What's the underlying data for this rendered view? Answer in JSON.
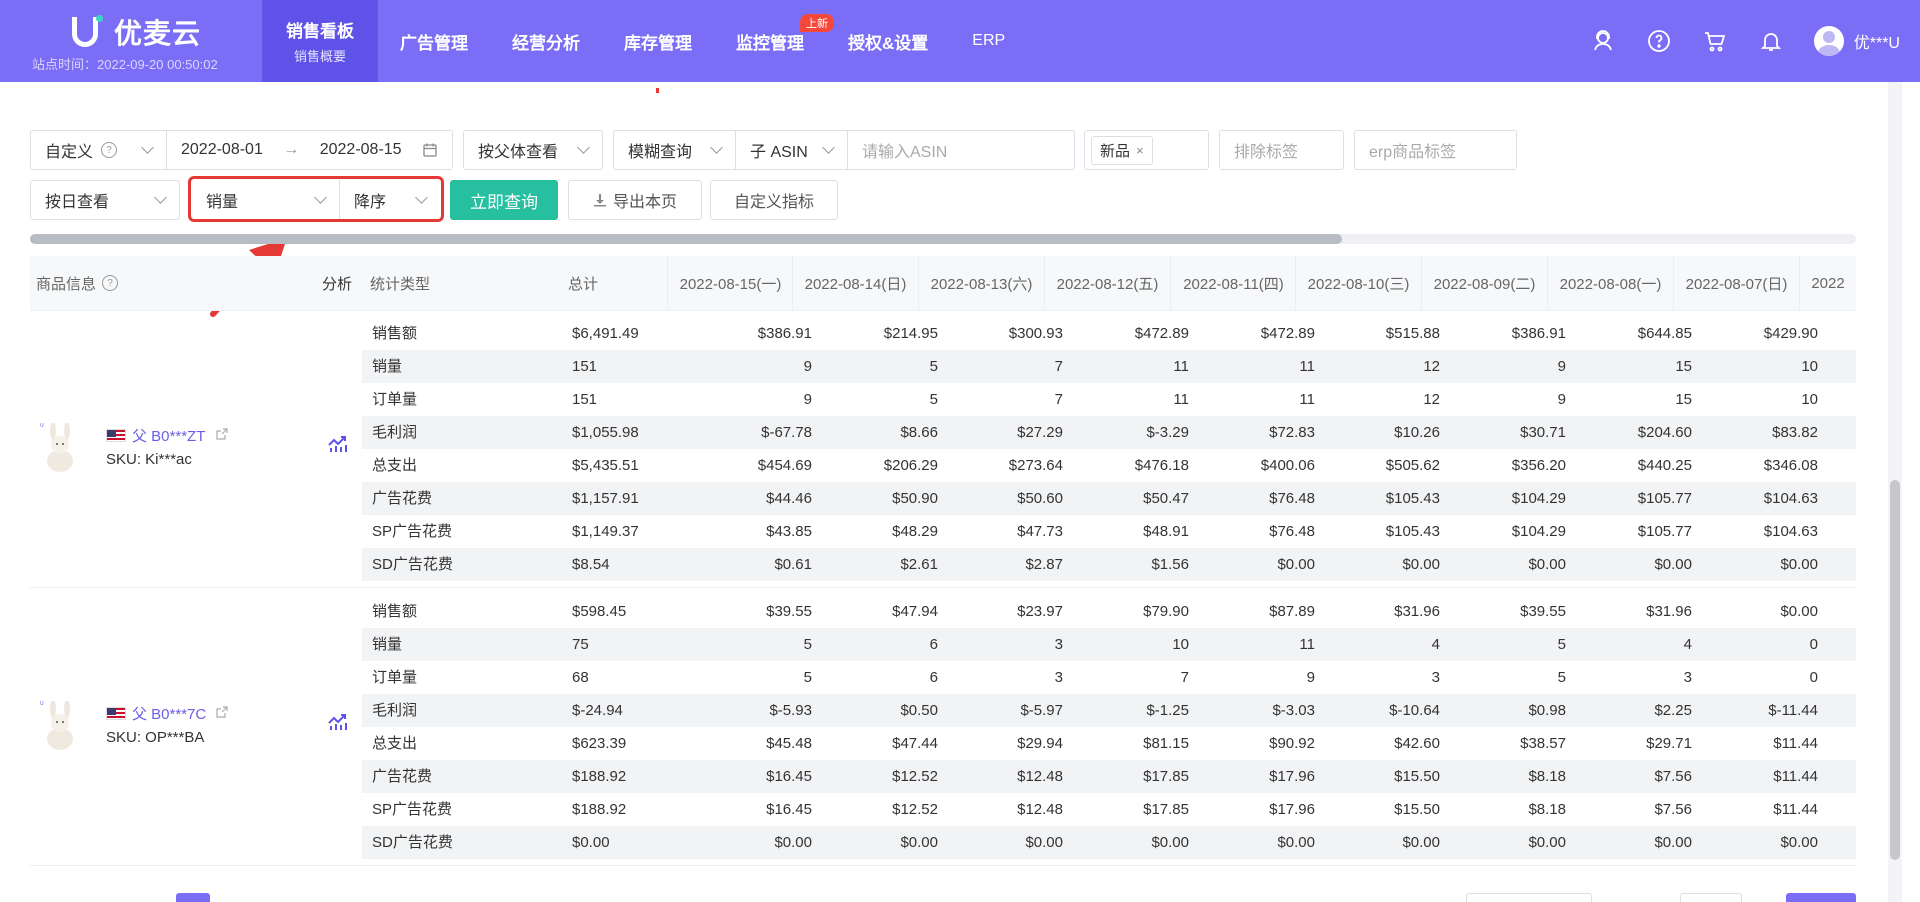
{
  "header": {
    "logo_text": "优麦云",
    "site_time": "站点时间：2022-09-20 00:50:02",
    "nav": [
      {
        "label": "销售看板",
        "sub": "销售概要",
        "active": true
      },
      {
        "label": "广告管理"
      },
      {
        "label": "经营分析"
      },
      {
        "label": "库存管理"
      },
      {
        "label": "监控管理",
        "badge": "上新"
      },
      {
        "label": "授权&设置"
      },
      {
        "label": "ERP"
      }
    ],
    "icons": [
      "support-icon",
      "help-icon",
      "cart-icon",
      "bell-icon"
    ],
    "user_name": "优***U"
  },
  "filters": {
    "date_mode": "自定义",
    "date_start": "2022-08-01",
    "date_end": "2022-08-15",
    "view_by": "按父体查看",
    "match_mode": "模糊查询",
    "asin_type": "子 ASIN",
    "asin_placeholder": "请输入ASIN",
    "tag_selected": "新品",
    "exclude_tag_placeholder": "排除标签",
    "erp_tag_placeholder": "erp商品标签",
    "period": "按日查看",
    "sort_field": "销量",
    "sort_order": "降序",
    "query_button": "立即查询",
    "export_button": "导出本页",
    "custom_metrics_button": "自定义指标"
  },
  "table": {
    "col_product": "商品信息",
    "col_analysis": "分析",
    "col_stat_type": "统计类型",
    "col_total": "总计",
    "date_columns": [
      "2022-08-15(一)",
      "2022-08-14(日)",
      "2022-08-13(六)",
      "2022-08-12(五)",
      "2022-08-11(四)",
      "2022-08-10(三)",
      "2022-08-09(二)",
      "2022-08-08(一)",
      "2022-08-07(日)",
      "2022"
    ],
    "products": [
      {
        "asin": "父 B0***ZT",
        "sku": "SKU: Ki***ac",
        "rows": [
          {
            "type": "销售额",
            "total": "$6,491.49",
            "values": [
              "$386.91",
              "$214.95",
              "$300.93",
              "$472.89",
              "$472.89",
              "$515.88",
              "$386.91",
              "$644.85",
              "$429.90"
            ]
          },
          {
            "type": "销量",
            "total": "151",
            "values": [
              "9",
              "5",
              "7",
              "11",
              "11",
              "12",
              "9",
              "15",
              "10"
            ]
          },
          {
            "type": "订单量",
            "total": "151",
            "values": [
              "9",
              "5",
              "7",
              "11",
              "11",
              "12",
              "9",
              "15",
              "10"
            ]
          },
          {
            "type": "毛利润",
            "total": "$1,055.98",
            "values": [
              "$-67.78",
              "$8.66",
              "$27.29",
              "$-3.29",
              "$72.83",
              "$10.26",
              "$30.71",
              "$204.60",
              "$83.82"
            ]
          },
          {
            "type": "总支出",
            "total": "$5,435.51",
            "values": [
              "$454.69",
              "$206.29",
              "$273.64",
              "$476.18",
              "$400.06",
              "$505.62",
              "$356.20",
              "$440.25",
              "$346.08"
            ]
          },
          {
            "type": "广告花费",
            "total": "$1,157.91",
            "values": [
              "$44.46",
              "$50.90",
              "$50.60",
              "$50.47",
              "$76.48",
              "$105.43",
              "$104.29",
              "$105.77",
              "$104.63"
            ]
          },
          {
            "type": "SP广告花费",
            "total": "$1,149.37",
            "values": [
              "$43.85",
              "$48.29",
              "$47.73",
              "$48.91",
              "$76.48",
              "$105.43",
              "$104.29",
              "$105.77",
              "$104.63"
            ]
          },
          {
            "type": "SD广告花费",
            "total": "$8.54",
            "values": [
              "$0.61",
              "$2.61",
              "$2.87",
              "$1.56",
              "$0.00",
              "$0.00",
              "$0.00",
              "$0.00",
              "$0.00"
            ]
          }
        ]
      },
      {
        "asin": "父 B0***7C",
        "sku": "SKU: OP***BA",
        "rows": [
          {
            "type": "销售额",
            "total": "$598.45",
            "values": [
              "$39.55",
              "$47.94",
              "$23.97",
              "$79.90",
              "$87.89",
              "$31.96",
              "$39.55",
              "$31.96",
              "$0.00"
            ]
          },
          {
            "type": "销量",
            "total": "75",
            "values": [
              "5",
              "6",
              "3",
              "10",
              "11",
              "4",
              "5",
              "4",
              "0"
            ]
          },
          {
            "type": "订单量",
            "total": "68",
            "values": [
              "5",
              "6",
              "3",
              "7",
              "9",
              "3",
              "5",
              "3",
              "0"
            ]
          },
          {
            "type": "毛利润",
            "total": "$-24.94",
            "values": [
              "$-5.93",
              "$0.50",
              "$-5.97",
              "$-1.25",
              "$-3.03",
              "$-10.64",
              "$0.98",
              "$2.25",
              "$-11.44"
            ]
          },
          {
            "type": "总支出",
            "total": "$623.39",
            "values": [
              "$45.48",
              "$47.44",
              "$29.94",
              "$81.15",
              "$90.92",
              "$42.60",
              "$38.57",
              "$29.71",
              "$11.44"
            ]
          },
          {
            "type": "广告花费",
            "total": "$188.92",
            "values": [
              "$16.45",
              "$12.52",
              "$12.48",
              "$17.85",
              "$17.96",
              "$15.50",
              "$8.18",
              "$7.56",
              "$11.44"
            ]
          },
          {
            "type": "SP广告花费",
            "total": "$188.92",
            "values": [
              "$16.45",
              "$12.52",
              "$12.48",
              "$17.85",
              "$17.96",
              "$15.50",
              "$8.18",
              "$7.56",
              "$11.44"
            ]
          },
          {
            "type": "SD广告花费",
            "total": "$0.00",
            "values": [
              "$0.00",
              "$0.00",
              "$0.00",
              "$0.00",
              "$0.00",
              "$0.00",
              "$0.00",
              "$0.00",
              "$0.00"
            ]
          }
        ]
      }
    ]
  },
  "colors": {
    "brand": "#7b6ef6",
    "nav_active": "#5f52e8",
    "primary_button": "#26bfa0",
    "highlight": "#e53935",
    "link": "#6a5ee6"
  }
}
